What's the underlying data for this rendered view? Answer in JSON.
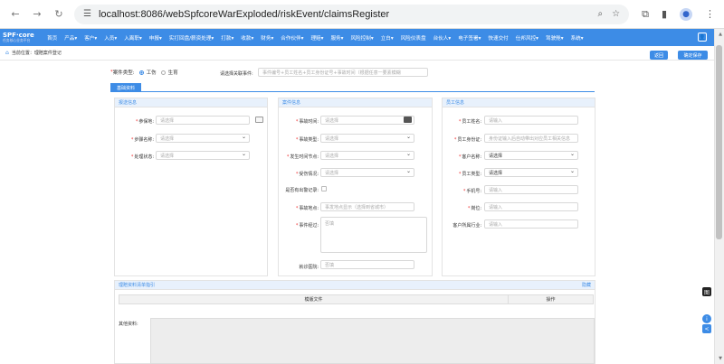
{
  "browser": {
    "url": "localhost:8086/webSpfcoreWarExploded/riskEvent/claimsRegister"
  },
  "app": {
    "logo_text": "SPF·core",
    "logo_sub": "任务核心业务平台",
    "menu": [
      "首页",
      "产品▾",
      "客户▾",
      "入员▾",
      "入离职▾",
      "申报▾",
      "实打回盘/薪资处理▾",
      "打款▾",
      "收款▾",
      "财务▾",
      "合作伙伴▾",
      "理赔▾",
      "服务▾",
      "风险控制▾",
      "立白▾",
      "风险仪表盘",
      "台伙人▾",
      "电子签署▾",
      "快速交付",
      "仕邦风控▾",
      "驾驶舱▾",
      "系统▾"
    ]
  },
  "breadcrumb": {
    "prefix": "当前位置：",
    "page": "理赔案件登记"
  },
  "actions": {
    "back": "返回",
    "save": "确定保存"
  },
  "case_type": {
    "label": "案件类型:",
    "options": [
      "工伤",
      "生育"
    ],
    "selected": "工伤"
  },
  "linked_event": {
    "label": "请选择关联事件:",
    "placeholder": "事件编号+员工姓名+员工身份证号+事故时间（根据任意一要素模糊"
  },
  "tab": "基础资料",
  "panels": {
    "report": {
      "title": "报送信息",
      "fields": [
        {
          "label": "参保地:",
          "value": "请选择",
          "required": true
        },
        {
          "label": "步骤名称:",
          "value": "请选择",
          "required": true
        },
        {
          "label": "处理状态:",
          "value": "请选择",
          "required": true
        }
      ]
    },
    "case": {
      "title": "案件信息",
      "fields": [
        {
          "label": "事故时间:",
          "value": "请选择",
          "required": true
        },
        {
          "label": "事故类型:",
          "value": "请选择",
          "required": true
        },
        {
          "label": "发生时间节点:",
          "value": "请选择",
          "required": true
        },
        {
          "label": "受伤情况:",
          "value": "请选择",
          "required": true
        },
        {
          "label": "是否有出警记录:",
          "value": "",
          "required": false
        },
        {
          "label": "事故地点:",
          "value": "事发地点显示（选择到省城市）",
          "required": true
        },
        {
          "label": "事件经过:",
          "value": "否填",
          "required": true
        },
        {
          "label": "就诊医院:",
          "value": "否填",
          "required": false
        }
      ]
    },
    "employee": {
      "title": "员工信息",
      "fields": [
        {
          "label": "员工姓名:",
          "value": "请输入",
          "required": true
        },
        {
          "label": "员工身份证:",
          "value": "身份证输入后自动带出对应员工相关信息",
          "required": true
        },
        {
          "label": "客户名称:",
          "value": "请选择",
          "required": true
        },
        {
          "label": "员工类型:",
          "value": "请选择",
          "required": true
        },
        {
          "label": "手机号:",
          "value": "请输入",
          "required": true
        },
        {
          "label": "岗位:",
          "value": "请输入",
          "required": true
        },
        {
          "label": "客户所属行业:",
          "value": "请输入",
          "required": false
        }
      ]
    }
  },
  "attachments": {
    "title": "理赔资料清单指引",
    "toggle": "隐藏",
    "columns": [
      "模版文件",
      "操作"
    ],
    "other_label": "其他资料:"
  },
  "float": {
    "chat": "图",
    "info": "i",
    "collapse": "<"
  }
}
